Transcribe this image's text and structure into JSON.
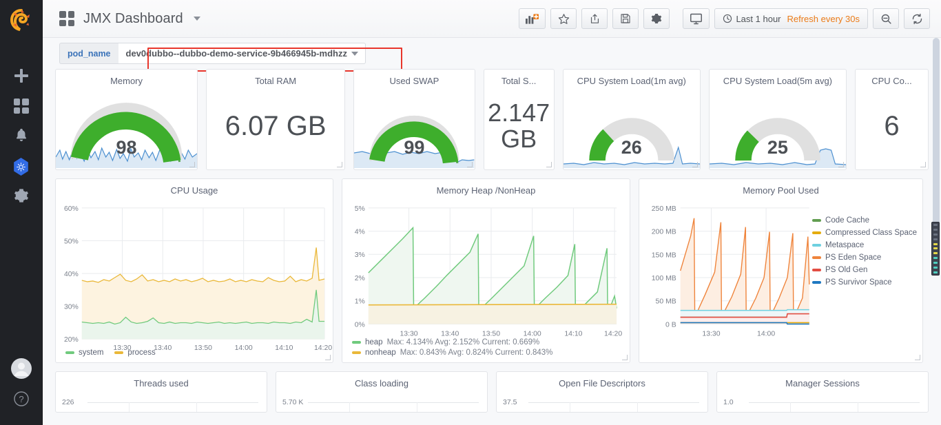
{
  "sidebar": {
    "logo_name": "grafana-logo",
    "items": [
      {
        "name": "create-add",
        "icon": "plus-icon",
        "label": "Create"
      },
      {
        "name": "dashboards",
        "icon": "grid-icon",
        "label": "Dashboards"
      },
      {
        "name": "alerting",
        "icon": "bell-icon",
        "label": "Alerting"
      },
      {
        "name": "kubernetes",
        "icon": "kubernetes-icon",
        "label": "Kubernetes"
      },
      {
        "name": "configuration",
        "icon": "gear-icon",
        "label": "Configuration"
      }
    ],
    "bottom": [
      {
        "name": "user-profile",
        "icon": "avatar-icon",
        "label": "Profile"
      },
      {
        "name": "help",
        "icon": "question-icon",
        "label": "Help"
      }
    ]
  },
  "navbar": {
    "dashboard_icon": "dashboard-grid-icon",
    "title": "JMX Dashboard",
    "title_caret": "▾",
    "buttons": [
      {
        "name": "add-panel-button",
        "icon": "add-panel-icon",
        "title": "Add panel"
      },
      {
        "name": "star-button",
        "icon": "star-icon",
        "title": "Mark as favorite"
      },
      {
        "name": "share-button",
        "icon": "share-icon",
        "title": "Share dashboard"
      },
      {
        "name": "save-button",
        "icon": "save-icon",
        "title": "Save dashboard"
      },
      {
        "name": "settings-button",
        "icon": "gear-icon",
        "title": "Dashboard settings"
      },
      {
        "name": "tv-mode-button",
        "icon": "monitor-icon",
        "title": "Cycle view mode"
      }
    ],
    "time_range": "Last 1 hour",
    "refresh_interval": "Refresh every 30s",
    "zoom_out_title": "Zoom out time range",
    "refresh_title": "Refresh dashboard"
  },
  "variables": {
    "label": "pod_name",
    "value": "dev0dubbo--dubbo-demo-service-9b466945b-mdhzz",
    "caret": "▾",
    "highlight_color": "#e8352b"
  },
  "colors": {
    "green": "#56a64b",
    "green_light": "#70ca7d",
    "amber": "#eab839",
    "orange": "#ef843c",
    "red": "#e24d42",
    "blue": "#6ed0e0",
    "dark_blue": "#1f78c1",
    "sparkline": "#4b8fd0",
    "gauge_track": "#e0e0e0",
    "accent_orange": "#eb7b18",
    "link_blue": "#3b73b9"
  },
  "stat_panels": [
    {
      "name": "panel-memory",
      "title": "Memory",
      "type": "gauge",
      "value": "98",
      "percent": 98,
      "sparkline": true
    },
    {
      "name": "panel-total-ram",
      "title": "Total RAM",
      "type": "singlestat",
      "value": "6.07 GB"
    },
    {
      "name": "panel-used-swap",
      "title": "Used SWAP",
      "type": "gauge",
      "value": "99",
      "percent": 99,
      "sparkline": true
    },
    {
      "name": "panel-total-swap",
      "title": "Total S...",
      "type": "singlestat",
      "value": "2.147 GB"
    },
    {
      "name": "panel-cpu-load-1m",
      "title": "CPU System Load(1m avg)",
      "type": "gauge",
      "value": "26",
      "percent": 26,
      "sparkline": true
    },
    {
      "name": "panel-cpu-load-5m",
      "title": "CPU System Load(5m avg)",
      "type": "gauge",
      "value": "25",
      "percent": 25,
      "sparkline": true
    },
    {
      "name": "panel-cpu-cores",
      "title": "CPU Co...",
      "type": "singlestat",
      "value": "6"
    }
  ],
  "chart_data": [
    {
      "name": "panel-cpu-usage",
      "type": "area",
      "title": "CPU Usage",
      "xlabel": "",
      "ylabel": "",
      "ylim": [
        20,
        60
      ],
      "ytick_labels": [
        "20%",
        "30%",
        "40%",
        "50%",
        "60%"
      ],
      "xtick_labels": [
        "13:30",
        "13:40",
        "13:50",
        "14:00",
        "14:10",
        "14:20"
      ],
      "grid": true,
      "legend_position": "bottom",
      "series": [
        {
          "name": "system",
          "color": "#70ca7d",
          "values": [
            25.3,
            25.0,
            24.8,
            25.1,
            24.9,
            25.2,
            24.7,
            25.0,
            26.3,
            25.1,
            24.8,
            25.0,
            25.4,
            26.2,
            25.0,
            24.9,
            25.2,
            24.8,
            25.1,
            25.0,
            24.9,
            25.3,
            25.1,
            24.8,
            25.0,
            25.2,
            24.9,
            25.1,
            24.8,
            25.0,
            25.3,
            24.9,
            25.1,
            25.0,
            24.8,
            25.2,
            25.0,
            25.1,
            24.9,
            25.3,
            25.0,
            26.0,
            25.2,
            35.1,
            25.4,
            25.0,
            25.2,
            24.9,
            25.1,
            25.5
          ]
        },
        {
          "name": "process",
          "color": "#eab839",
          "values": [
            42.4,
            42.1,
            42.3,
            42.0,
            42.5,
            42.2,
            42.8,
            43.4,
            42.3,
            42.1,
            42.6,
            43.3,
            42.2,
            42.4,
            42.0,
            42.3,
            42.1,
            42.5,
            42.2,
            42.4,
            42.0,
            42.3,
            42.6,
            42.1,
            42.3,
            42.0,
            42.2,
            42.5,
            42.1,
            42.3,
            42.0,
            42.4,
            42.2,
            42.1,
            42.7,
            42.3,
            42.0,
            42.2,
            43.0,
            42.1,
            42.4,
            42.2,
            42.6,
            52.4,
            42.3,
            43.1,
            42.0,
            42.4,
            42.2,
            42.6
          ]
        }
      ]
    },
    {
      "name": "panel-memory-heap-nonheap",
      "type": "area",
      "title": "Memory Heap /NonHeap",
      "ylim": [
        0,
        5
      ],
      "ytick_labels": [
        "0%",
        "1%",
        "2%",
        "3%",
        "4%",
        "5%"
      ],
      "xtick_labels": [
        "13:30",
        "13:40",
        "13:50",
        "14:00",
        "14:10",
        "14:20"
      ],
      "grid": true,
      "legend_position": "bottom",
      "series": [
        {
          "name": "heap",
          "color": "#70ca7d",
          "stats": "Max: 4.134%  Avg: 2.152%  Current: 0.669%",
          "max": "4.134%",
          "avg": "2.152%",
          "current": "0.669%",
          "values": [
            2.2,
            2.7,
            3.2,
            3.7,
            4.13,
            0.68,
            1.2,
            1.7,
            2.2,
            2.7,
            3.2,
            3.6,
            3.87,
            0.6,
            1.1,
            1.6,
            2.1,
            2.6,
            3.1,
            3.5,
            3.79,
            0.66,
            1.1,
            1.6,
            2.1,
            2.5,
            3.0,
            3.44,
            0.45,
            0.9,
            1.4,
            1.9,
            2.4,
            2.9,
            3.26,
            0.44,
            0.9,
            1.4,
            1.9,
            2.4,
            2.9,
            3.37,
            0.669
          ]
        },
        {
          "name": "nonheap",
          "color": "#eab839",
          "stats": "Max: 0.843%  Avg: 0.824%  Current: 0.843%",
          "max": "0.843%",
          "avg": "0.824%",
          "current": "0.843%",
          "values": [
            0.82,
            0.82,
            0.82,
            0.82,
            0.82,
            0.82,
            0.82,
            0.82,
            0.82,
            0.82,
            0.82,
            0.82,
            0.82,
            0.82,
            0.82,
            0.82,
            0.82,
            0.82,
            0.82,
            0.82,
            0.82,
            0.82,
            0.83,
            0.83,
            0.83,
            0.83,
            0.83,
            0.83,
            0.83,
            0.83,
            0.83,
            0.83,
            0.84,
            0.84,
            0.84,
            0.84,
            0.84,
            0.84,
            0.843,
            0.843,
            0.843,
            0.843,
            0.843
          ]
        }
      ]
    },
    {
      "name": "panel-memory-pool-used",
      "type": "area",
      "title": "Memory Pool Used",
      "ylim": [
        0,
        250
      ],
      "ytick_labels": [
        "0 B",
        "50 MB",
        "100 MB",
        "150 MB",
        "200 MB",
        "250 MB"
      ],
      "xtick_labels": [
        "13:30",
        "14:00"
      ],
      "grid": true,
      "legend_position": "right",
      "series": [
        {
          "name": "Code Cache",
          "color": "#629e51",
          "values": [
            14,
            14,
            14,
            14,
            14,
            14,
            14,
            14,
            14,
            14,
            14,
            14,
            14,
            14,
            14,
            15,
            15,
            15,
            15,
            15,
            15
          ]
        },
        {
          "name": "Compressed Class Space",
          "color": "#e5ac0e",
          "values": [
            3,
            3,
            3,
            3,
            3,
            3,
            3,
            3,
            3,
            3,
            3,
            3,
            3,
            3,
            3,
            3,
            3,
            3,
            3,
            3,
            3
          ]
        },
        {
          "name": "Metaspace",
          "color": "#6ed0e0",
          "values": [
            29,
            29,
            29,
            29,
            29,
            29,
            29,
            29,
            29,
            29,
            29,
            29,
            29,
            29,
            29,
            30,
            30,
            30,
            30,
            30,
            30
          ]
        },
        {
          "name": "PS Eden Space",
          "color": "#ef843c",
          "values": [
            115,
            172,
            230,
            15,
            75,
            140,
            218,
            10,
            80,
            145,
            209,
            12,
            85,
            150,
            198,
            14,
            95,
            160,
            196,
            18,
            190
          ]
        },
        {
          "name": "PS Old Gen",
          "color": "#e24d42",
          "values": [
            15,
            15,
            15,
            15,
            15,
            15,
            15,
            15,
            15,
            15,
            15,
            15,
            15,
            15,
            15,
            22,
            22,
            22,
            22,
            22,
            22
          ]
        },
        {
          "name": "PS Survivor Space",
          "color": "#1f78c1",
          "values": [
            2,
            2,
            2,
            2,
            2,
            2,
            2,
            2,
            2,
            2,
            2,
            2,
            2,
            2,
            2,
            1,
            1,
            1,
            1,
            1,
            1
          ]
        }
      ]
    }
  ],
  "bottom_panels": [
    {
      "name": "panel-threads-used",
      "title": "Threads used",
      "axis_value": "226"
    },
    {
      "name": "panel-class-loading",
      "title": "Class loading",
      "axis_value": "5.70 K"
    },
    {
      "name": "panel-open-file-descriptors",
      "title": "Open File Descriptors",
      "axis_value": "37.5"
    },
    {
      "name": "panel-manager-sessions",
      "title": "Manager Sessions",
      "axis_value": "1.0"
    }
  ]
}
